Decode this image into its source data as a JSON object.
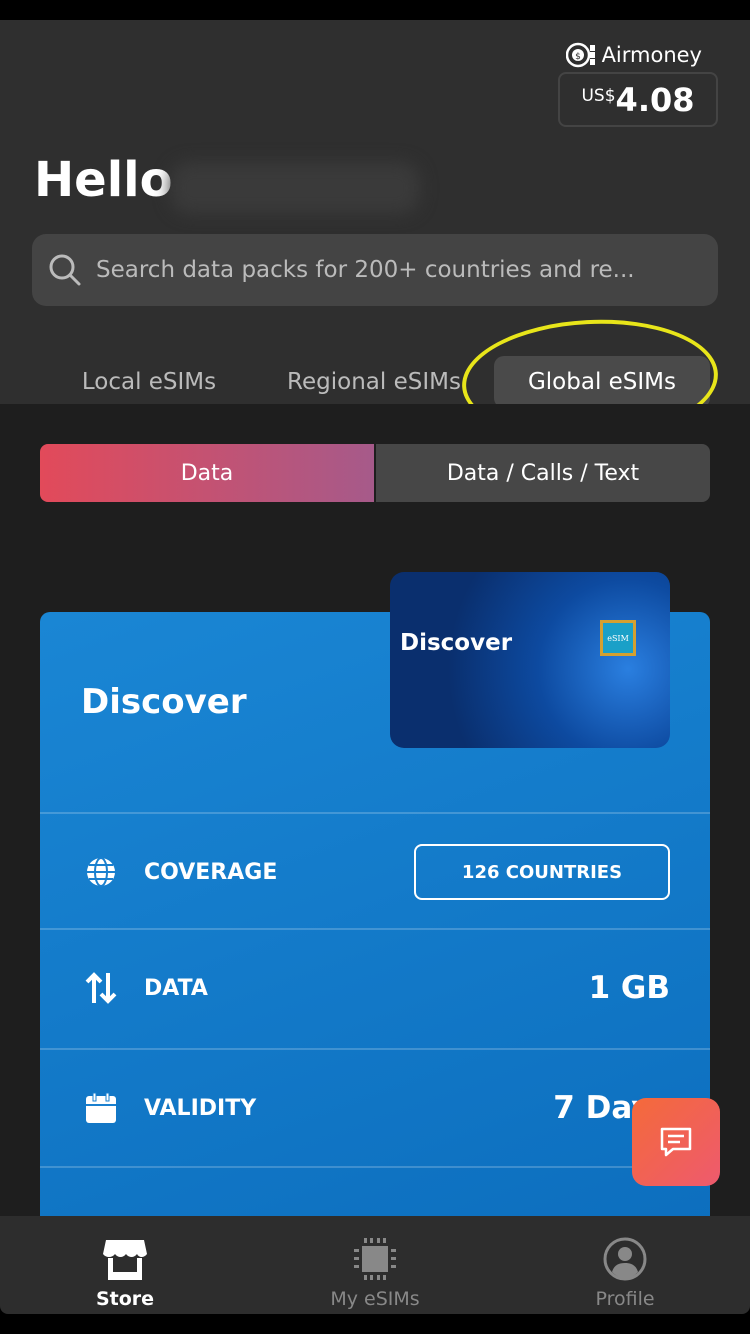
{
  "airmoney": {
    "label": "Airmoney",
    "currency": "US$",
    "amount": "4.08",
    "icon": "coin-icon"
  },
  "greeting": "Hello",
  "search": {
    "placeholder": "Search data packs for 200+ countries and re..."
  },
  "tabs": [
    {
      "label": "Local eSIMs",
      "active": false
    },
    {
      "label": "Regional eSIMs",
      "active": false
    },
    {
      "label": "Global eSIMs",
      "active": true
    }
  ],
  "annotation_color": "#e8e51a",
  "segments": [
    {
      "label": "Data",
      "active": true
    },
    {
      "label": "Data / Calls / Text",
      "active": false
    }
  ],
  "card": {
    "title": "Discover",
    "thumbnail_title": "Discover",
    "chip_label": "eSIM",
    "rows": [
      {
        "icon": "globe-icon",
        "label": "COVERAGE",
        "value": "126 COUNTRIES"
      },
      {
        "icon": "arrows-up-down-icon",
        "label": "DATA",
        "value": "1 GB"
      },
      {
        "icon": "calendar-icon",
        "label": "VALIDITY",
        "value": "7 Days"
      }
    ]
  },
  "nav": [
    {
      "label": "Store",
      "icon": "store-icon",
      "active": true
    },
    {
      "label": "My eSIMs",
      "icon": "chip-icon",
      "active": false
    },
    {
      "label": "Profile",
      "icon": "profile-icon",
      "active": false
    }
  ],
  "colors": {
    "accent_gradient_start": "#e24a5a",
    "card_blue": "#1a86d4",
    "chat_button": "#f46a3a"
  }
}
